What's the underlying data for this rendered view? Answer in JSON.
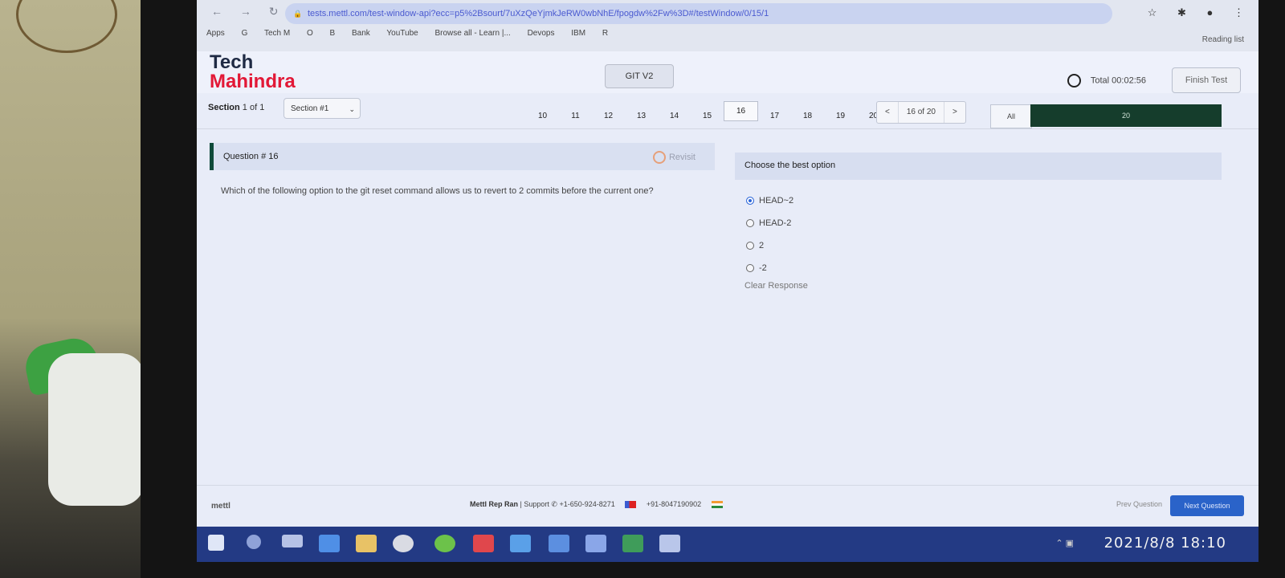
{
  "browser": {
    "url": "tests.mettl.com/test-window-api?ecc=p5%2Bsourt/7uXzQeYjmkJeRW0wbNhE/fpogdw%2Fw%3D#/testWindow/0/15/1",
    "bookmarks": [
      "Apps",
      "G",
      "Tech M",
      "O",
      "B",
      "Bank",
      "YouTube",
      "Browse all - Learn |...",
      "Devops",
      "IBM",
      "R"
    ],
    "reading_list": "Reading list"
  },
  "header": {
    "logo_line1": "Tech",
    "logo_line2": "Mahindra",
    "test_name": "GIT V2",
    "timer": "Total 00:02:56",
    "finish_label": "Finish Test"
  },
  "section": {
    "label": "Section",
    "info": "1 of 1",
    "select_value": "Section #1",
    "question_numbers": [
      "10",
      "11",
      "12",
      "13",
      "14",
      "15",
      "16",
      "17",
      "18",
      "19",
      "20"
    ],
    "active_question": "16",
    "pager_prev": "<",
    "pager_value": "16 of 20",
    "pager_next": ">",
    "filter": "All",
    "progress_label": "20"
  },
  "question": {
    "title": "Question # 16",
    "revisit": "Revisit",
    "text": "Which of the following option to the git reset command allows us to revert to 2 commits before the current one?"
  },
  "answers": {
    "title": "Choose the best option",
    "options": [
      "HEAD~2",
      "HEAD-2",
      "2",
      "-2"
    ],
    "selected_index": 0,
    "clear": "Clear Response"
  },
  "footer": {
    "logo": "mettl",
    "support_name": "Mettl Rep Ran",
    "support_label": "| Support",
    "phone1": "+1-650-924-8271",
    "phone2": "+91-8047190902",
    "prev": "Prev Question",
    "next": "Next Question"
  },
  "taskbar": {
    "datetime": "2021/8/8 18:10"
  }
}
